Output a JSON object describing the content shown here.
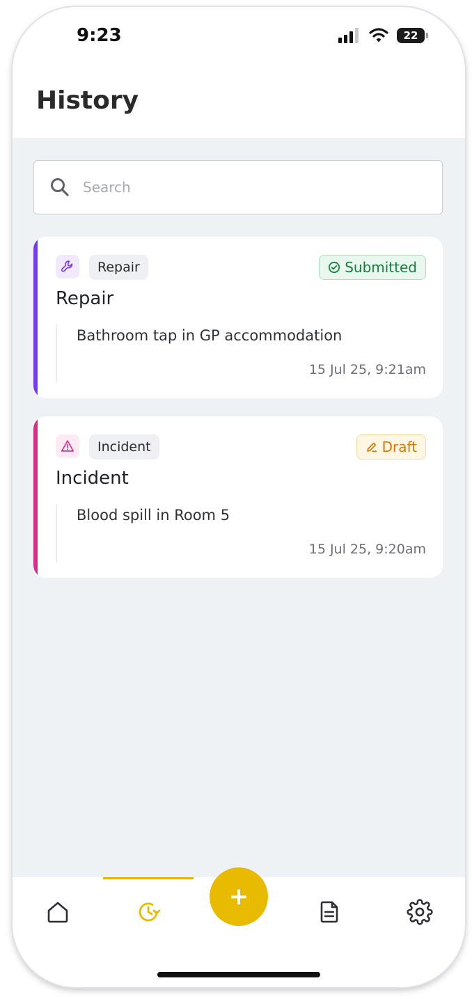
{
  "status_bar": {
    "time": "9:23",
    "battery": "22"
  },
  "header": {
    "title": "History"
  },
  "search": {
    "placeholder": "Search"
  },
  "items": [
    {
      "type_label": "Repair",
      "title": "Repair",
      "description": "Bathroom tap in GP accommodation",
      "date": "15 Jul 25, 9:21am",
      "status": "Submitted",
      "accent_color": "#7c3aed",
      "icon": "wrench-icon"
    },
    {
      "type_label": "Incident",
      "title": "Incident",
      "description": "Blood spill in Room 5",
      "date": "15 Jul 25, 9:20am",
      "status": "Draft",
      "accent_color": "#d92d8a",
      "icon": "warning-icon"
    }
  ],
  "nav": {
    "items": [
      "home-icon",
      "history-icon",
      "add-icon",
      "document-icon",
      "settings-icon"
    ],
    "fab_label": "+",
    "active": "history"
  },
  "colors": {
    "accent_yellow": "#e9bb00",
    "submitted_green": "#15803d",
    "draft_orange": "#d97706"
  }
}
